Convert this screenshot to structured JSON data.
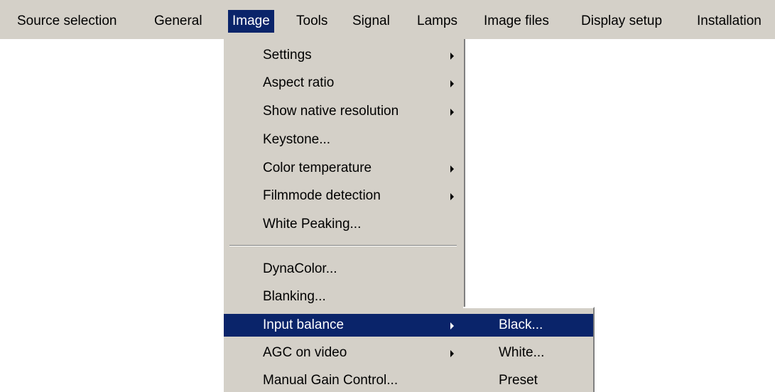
{
  "menubar": {
    "items": [
      {
        "label": "Source selection"
      },
      {
        "label": "General"
      },
      {
        "label": "Image",
        "active": true
      },
      {
        "label": "Tools"
      },
      {
        "label": "Signal"
      },
      {
        "label": "Lamps"
      },
      {
        "label": "Image files"
      },
      {
        "label": "Display setup"
      },
      {
        "label": "Installation"
      }
    ]
  },
  "image_menu": {
    "items": [
      {
        "label": "Settings",
        "has_submenu": true
      },
      {
        "label": "Aspect ratio",
        "has_submenu": true
      },
      {
        "label": "Show native resolution",
        "has_submenu": true
      },
      {
        "label": "Keystone...",
        "has_submenu": false
      },
      {
        "label": "Color temperature",
        "has_submenu": true
      },
      {
        "label": "Filmmode detection",
        "has_submenu": true
      },
      {
        "label": "White Peaking...",
        "has_submenu": false
      },
      {
        "label": "DynaColor...",
        "has_submenu": false
      },
      {
        "label": "Blanking...",
        "has_submenu": false
      },
      {
        "label": "Input balance",
        "has_submenu": true,
        "selected": true
      },
      {
        "label": "AGC on video",
        "has_submenu": true
      },
      {
        "label": "Manual Gain Control...",
        "has_submenu": false
      }
    ]
  },
  "input_balance_submenu": {
    "items": [
      {
        "label": "Black...",
        "selected": true
      },
      {
        "label": "White..."
      },
      {
        "label": "Preset"
      }
    ]
  },
  "colors": {
    "menu_background": "#d4d0c8",
    "highlight": "#0a246a",
    "highlight_text": "#ffffff"
  },
  "icons": {
    "submenu_indicator": "submenu-arrow-icon"
  }
}
